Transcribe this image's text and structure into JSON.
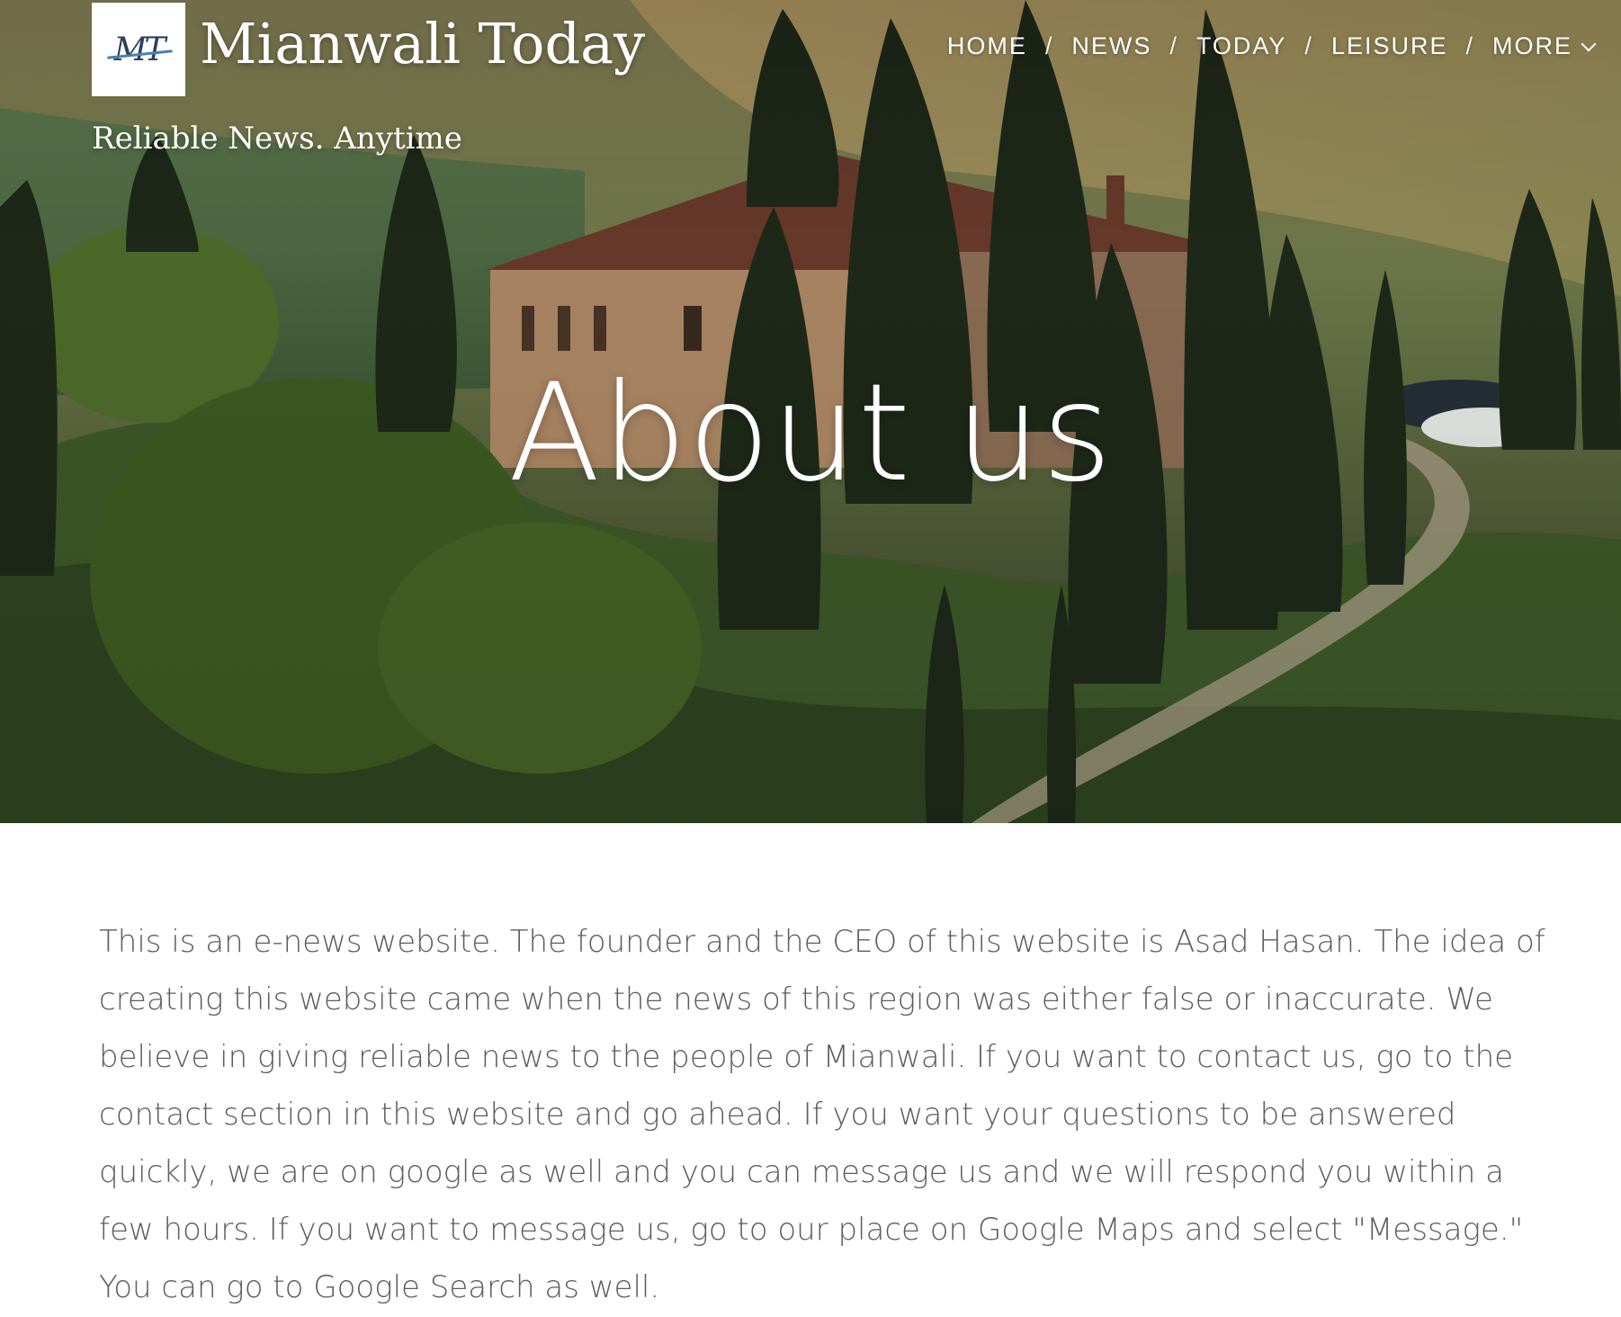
{
  "header": {
    "logo_initials": "MT",
    "site_title": "Mianwali Today",
    "tagline": "Reliable News. Anytime"
  },
  "nav": {
    "items": [
      {
        "label": "HOME"
      },
      {
        "label": "NEWS"
      },
      {
        "label": "TODAY"
      },
      {
        "label": "LEISURE"
      },
      {
        "label": "MORE"
      }
    ],
    "separator": "/"
  },
  "hero": {
    "title": "About us"
  },
  "main": {
    "about_text": "This is an e-news website. The founder and the CEO of this website is Asad Hasan. The idea of creating this website came when the news of this region was either false or inaccurate. We believe in giving reliable news to the people of Mianwali. If you want to contact us, go to the contact section in this website and go ahead. If you want your questions to be answered quickly, we are on google as well and you can message us and we will respond you within a few hours. If you want to message us, go to our place on Google Maps and select \"Message.\" You can go to Google Search as well."
  },
  "colors": {
    "body_text": "#5d5d5d",
    "logo_text": "#2a3f5a",
    "logo_accent": "#4b7fae"
  },
  "icons": {
    "more_dropdown": "chevron-down-icon"
  }
}
